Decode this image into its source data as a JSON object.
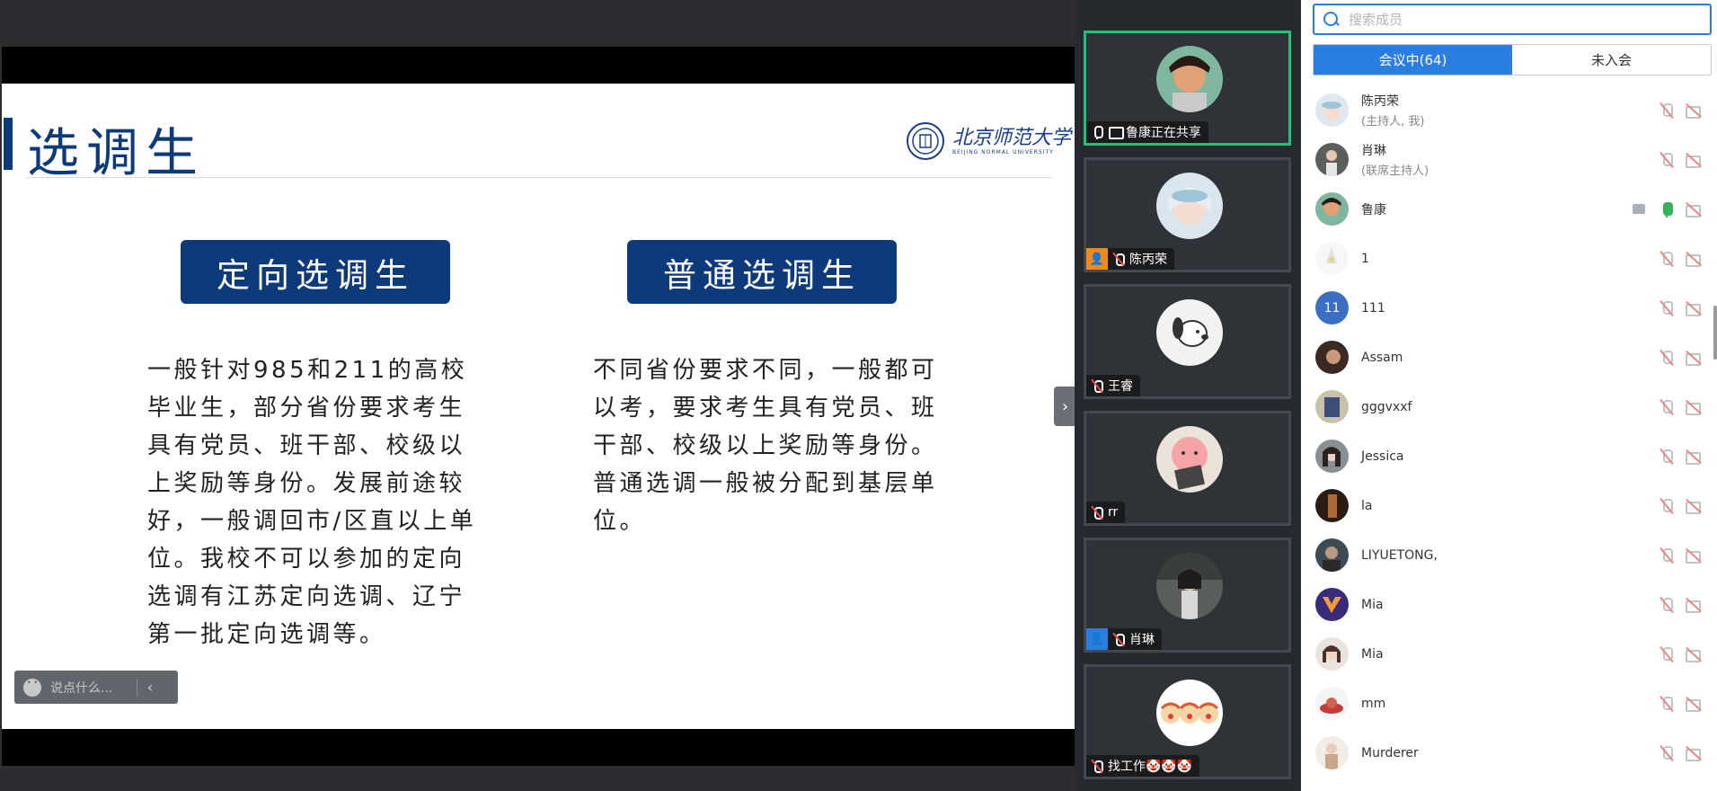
{
  "slide": {
    "title": "选调生",
    "logo_text": "北京师范大学",
    "logo_sub": "BEIJING NORMAL UNIVERSITY",
    "pill_left": "定向选调生",
    "pill_right": "普通选调生",
    "para_left": "一般针对985和211的高校毕业生，部分省份要求考生具有党员、班干部、校级以上奖励等身份。发展前途较好，一般调回市/区直以上单位。我校不可以参加的定向选调有江苏定向选调、辽宁第一批定向选调等。",
    "para_right": "不同省份要求不同，一般都可以考，要求考生具有党员、班干部、校级以上奖励等身份。普通选调一般被分配到基层单位。"
  },
  "chat": {
    "placeholder": "说点什么..."
  },
  "videos": [
    {
      "label": "鲁康正在共享",
      "icon": "screen-share-icon",
      "active": true
    },
    {
      "label": "陈丙荣",
      "badge": "host-badge"
    },
    {
      "label": "王睿"
    },
    {
      "label": "rr"
    },
    {
      "label": "肖琳",
      "badge": "cohost-badge"
    },
    {
      "label": "找工作🤡🤡🤡"
    }
  ],
  "panel": {
    "search_placeholder": "搜索成员",
    "tab_in_meeting": "会议中(64)",
    "tab_not_joined": "未入会",
    "members": [
      {
        "name": "陈丙荣",
        "role": "(主持人, 我)"
      },
      {
        "name": "肖琳",
        "role": "(联席主持人)"
      },
      {
        "name": "鲁康",
        "role": "",
        "sharing": true,
        "mic_on": true
      },
      {
        "name": "1",
        "role": ""
      },
      {
        "name": "111",
        "role": "",
        "avatar_text": "11"
      },
      {
        "name": "Assam",
        "role": ""
      },
      {
        "name": "gggvxxf",
        "role": ""
      },
      {
        "name": "Jessica",
        "role": ""
      },
      {
        "name": "la",
        "role": ""
      },
      {
        "name": "LIYUETONG,",
        "role": ""
      },
      {
        "name": "Mia",
        "role": ""
      },
      {
        "name": "Mia",
        "role": ""
      },
      {
        "name": "mm",
        "role": ""
      },
      {
        "name": "Murderer",
        "role": ""
      }
    ]
  },
  "colors": {
    "slide_blue": "#0d3a7a",
    "accent_blue": "#2a7de1",
    "active_green": "#24c07a"
  }
}
